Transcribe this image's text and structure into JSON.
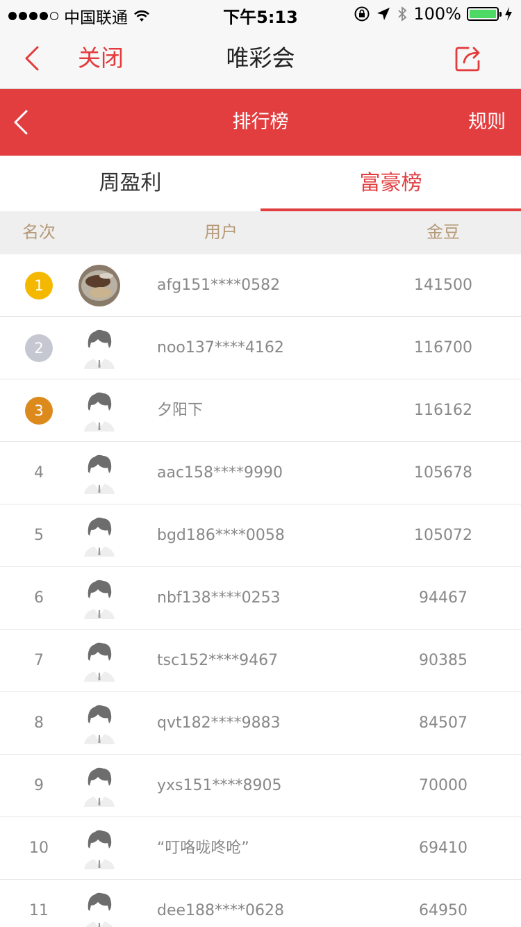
{
  "status_bar": {
    "carrier": "中国联通",
    "time": "下午5:13",
    "battery": "100%"
  },
  "nav": {
    "close_label": "关闭",
    "title": "唯彩会"
  },
  "header": {
    "title": "排行榜",
    "rules_label": "规则"
  },
  "tabs": [
    {
      "label": "周盈利",
      "active": false
    },
    {
      "label": "富豪榜",
      "active": true
    }
  ],
  "columns": {
    "rank": "名次",
    "user": "用户",
    "gold": "金豆"
  },
  "colors": {
    "accent": "#e23e40",
    "gold_badge": "#f5b800",
    "silver_badge": "#c5c8d0",
    "bronze_badge": "#dd8a1c"
  },
  "rows": [
    {
      "rank": "1",
      "name": "afg151****0582",
      "gold": "141500",
      "avatar": "photo-avatar"
    },
    {
      "rank": "2",
      "name": "noo137****4162",
      "gold": "116700",
      "avatar": "default-avatar"
    },
    {
      "rank": "3",
      "name": "夕阳下",
      "gold": "116162",
      "avatar": "default-avatar"
    },
    {
      "rank": "4",
      "name": "aac158****9990",
      "gold": "105678",
      "avatar": "default-avatar"
    },
    {
      "rank": "5",
      "name": "bgd186****0058",
      "gold": "105072",
      "avatar": "default-avatar"
    },
    {
      "rank": "6",
      "name": "nbf138****0253",
      "gold": "94467",
      "avatar": "default-avatar"
    },
    {
      "rank": "7",
      "name": "tsc152****9467",
      "gold": "90385",
      "avatar": "default-avatar"
    },
    {
      "rank": "8",
      "name": "qvt182****9883",
      "gold": "84507",
      "avatar": "default-avatar"
    },
    {
      "rank": "9",
      "name": "yxs151****8905",
      "gold": "70000",
      "avatar": "default-avatar"
    },
    {
      "rank": "10",
      "name": "“叮咯咙咚呛”",
      "gold": "69410",
      "avatar": "default-avatar"
    },
    {
      "rank": "11",
      "name": "dee188****0628",
      "gold": "64950",
      "avatar": "default-avatar"
    }
  ]
}
